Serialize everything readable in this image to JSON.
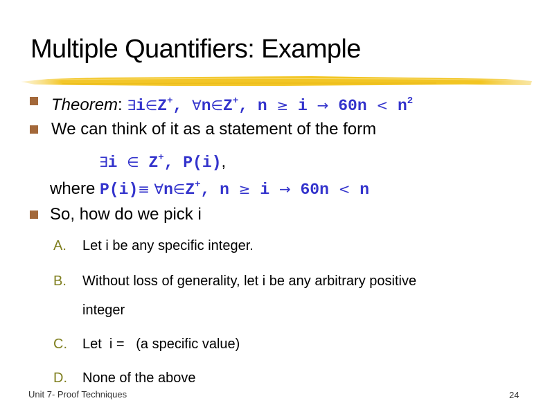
{
  "slide": {
    "title": "Multiple Quantifiers: Example",
    "accent_colors": {
      "brush_stroke": "#f2c522",
      "bullet": "#a3683a",
      "math_text": "#3333cc",
      "sub_letter": "#7f7f1f"
    },
    "bullets": [
      {
        "label": "Theorem",
        "label_sep": ": ",
        "math": {
          "exists": "∃",
          "i1": "i",
          "in1": "∈",
          "Z1": "Z",
          "plus1": "+",
          "comma1": ", ",
          "forall": "∀",
          "n1": "n",
          "in2": "∈",
          "Z2": "Z",
          "plus2": "+",
          "comma2": ", n ",
          "geq": "≥",
          "i2": " i ",
          "arrow": "→",
          "rhs": " 60n ",
          "lt": "<",
          "n2": " n",
          "exp": "2"
        }
      },
      {
        "text": "We can think of it as a statement of the form",
        "form_line": {
          "exists": "∃",
          "i": "i ",
          "in": "∈",
          "Z": " Z",
          "plus": "+",
          "rest": ", P(i)",
          "trail": ","
        },
        "where_line": {
          "where": "where ",
          "pi": "P(i)",
          "equiv": "≡ ",
          "forall": "∀",
          "n": "n",
          "in": "∈",
          "Z": "Z",
          "plus": "+",
          "mid": ", n ",
          "geq": "≥",
          "i": " i ",
          "arrow": "→",
          "rhs": " 60n ",
          "lt": "<",
          "n2": " n"
        }
      },
      {
        "text": "So, how do we pick i"
      }
    ],
    "options": [
      {
        "letter": "A.",
        "text": "Let i be any specific integer."
      },
      {
        "letter": "B.",
        "text": "Without loss of generality, let i be any arbitrary positive",
        "continuation": "integer"
      },
      {
        "letter": "C.",
        "text": "Let  i =   (a specific value)"
      },
      {
        "letter": "D.",
        "text": "None of the above"
      }
    ],
    "footer": {
      "left": "Unit 7- Proof Techniques",
      "page_number": "24"
    }
  }
}
